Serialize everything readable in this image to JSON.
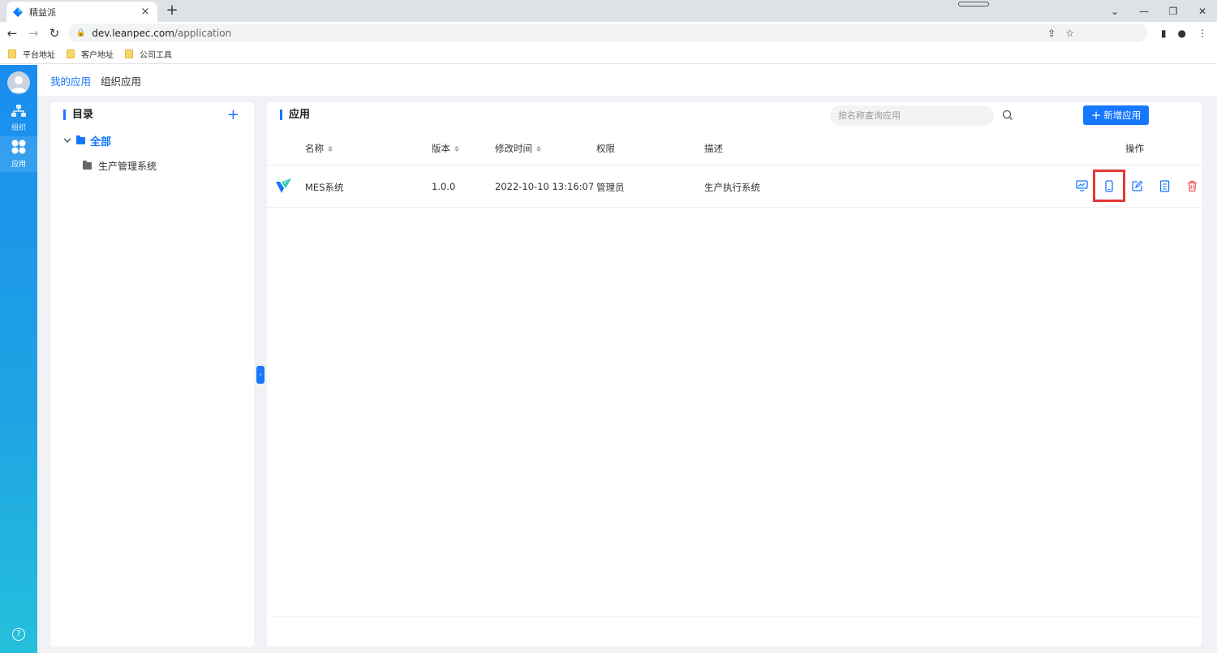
{
  "browser": {
    "tab_title": "精益派",
    "tab_close": "×",
    "new_tab": "+",
    "url_host": "dev.leanpec.com",
    "url_path": "/application",
    "bookmarks": [
      "平台地址",
      "客户地址",
      "公司工具"
    ]
  },
  "app": {
    "sidebar": {
      "items": [
        {
          "label": "组织",
          "icon": "org-chart-icon"
        },
        {
          "label": "应用",
          "icon": "apps-grid-icon"
        }
      ],
      "help": "?"
    },
    "topnav": {
      "tabs": [
        {
          "label": "我的应用",
          "active": true
        },
        {
          "label": "组织应用",
          "active": false
        }
      ]
    },
    "directory": {
      "title": "目录",
      "add": "+",
      "root": "全部",
      "children": [
        "生产管理系统"
      ]
    },
    "applications": {
      "title": "应用",
      "search_placeholder": "按名称查询应用",
      "add_button": "新增应用",
      "columns": {
        "name": "名称",
        "version": "版本",
        "modified": "修改时间",
        "permission": "权限",
        "description": "描述",
        "actions": "操作"
      },
      "rows": [
        {
          "name": "MES系统",
          "version": "1.0.0",
          "modified": "2022-10-10 13:16:07",
          "permission": "管理员",
          "description": "生产执行系统"
        }
      ]
    }
  },
  "colors": {
    "primary": "#1677ff",
    "danger": "#f05454",
    "highlight": "#e53935"
  }
}
